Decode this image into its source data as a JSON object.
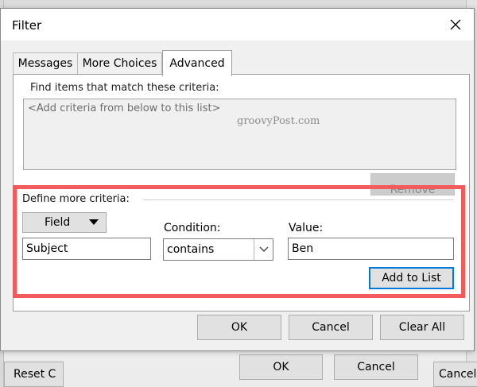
{
  "background": {
    "reset_label": "Reset C",
    "ok_label": "OK",
    "cancel_label": "Cancel",
    "cancel2_label": "Cancel"
  },
  "dialog": {
    "title": "Filter",
    "close_icon": "close-icon",
    "tabs": [
      {
        "label": "Messages"
      },
      {
        "label": "More Choices"
      },
      {
        "label": "Advanced",
        "active": true
      }
    ],
    "find_label": "Find items that match these criteria:",
    "criteria_placeholder": "<Add criteria from below to this list>",
    "watermark": "groovyPost.com",
    "remove_label": "Remove",
    "define": {
      "label": "Define more criteria:",
      "field_label": "Field",
      "condition_label": "Condition:",
      "value_label": "Value:",
      "subject_value": "Subject",
      "condition_value": "contains",
      "value_value": "Ben",
      "add_label": "Add to List"
    },
    "buttons": {
      "ok": "OK",
      "cancel": "Cancel",
      "clear_all": "Clear All"
    }
  },
  "colors": {
    "highlight": "#f15b5b",
    "focus_border": "#0078d7"
  }
}
